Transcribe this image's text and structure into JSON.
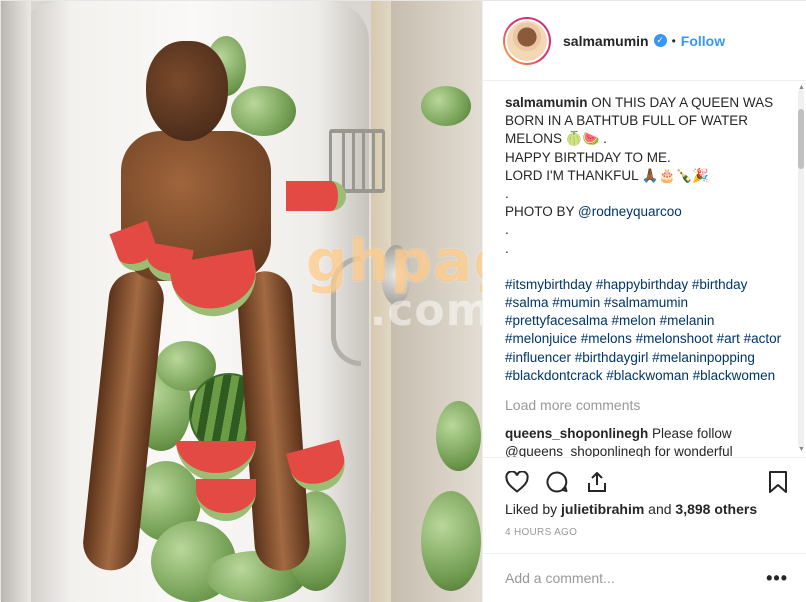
{
  "header": {
    "username": "salmamumin",
    "verified_glyph": "✓",
    "separator": "•",
    "follow_label": "Follow"
  },
  "caption": {
    "username": "salmamumin",
    "line1": "ON THIS DAY A QUEEN WAS BORN IN A BATHTUB FULL OF WATER MELONS 🍈🍉 .",
    "line2": "HAPPY BIRTHDAY TO ME.",
    "line3": "LORD I'M THANKFUL 🙏🏾🎂🍾🎉",
    "line4": ".",
    "photo_by": "PHOTO BY",
    "photo_mention": "@rodneyquarcoo",
    "line6": ".",
    "line7": ".",
    "hashtags": "#itsmybirthday #happybirthday #birthday #salma #mumin #salmamumin #prettyfacesalma #melon #melanin #melonjuice #melons #melonshoot #art #actor #influencer #birthdaygirl #melaninpopping #blackdontcrack #blackwoman #blackwomen"
  },
  "load_more_label": "Load more comments",
  "comment": {
    "username": "queens_shoponlinegh",
    "text": "Please follow @queens_shoponlinegh for wonderful"
  },
  "likes": {
    "prefix": "Liked by",
    "user": "julietibrahim",
    "joiner": "and",
    "count": "3,898 others"
  },
  "timestamp": "4 HOURS AGO",
  "add_comment_placeholder": "Add a comment...",
  "more_glyph": "•••",
  "watermark": {
    "top": "ghpage",
    "bottom": ".com"
  },
  "icons": {
    "like": "heart-icon",
    "comment": "comment-icon",
    "share": "share-icon",
    "save": "bookmark-icon",
    "verified": "verified-badge-icon"
  },
  "colors": {
    "link": "#3897f0",
    "hashtag": "#003569",
    "muted": "#999999",
    "text": "#262626"
  }
}
